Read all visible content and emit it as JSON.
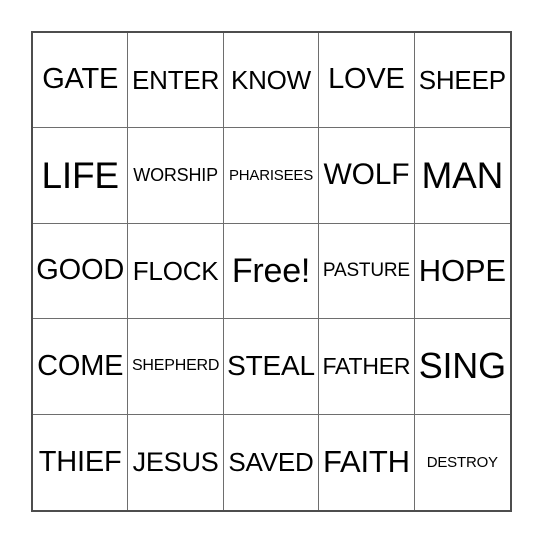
{
  "card": {
    "type": "bingo-card",
    "rows": 5,
    "columns": 5,
    "free_space": "Free!",
    "border_color": "#4d4d4d",
    "gridline_color": "#6e6e6e",
    "text_color": "#000000",
    "background_color": "#ffffff",
    "cells": [
      [
        {
          "label": "GATE",
          "size": "l"
        },
        {
          "label": "ENTER",
          "size": "m"
        },
        {
          "label": "KNOW",
          "size": "m"
        },
        {
          "label": "LOVE",
          "size": "l"
        },
        {
          "label": "SHEEP",
          "size": "m"
        }
      ],
      [
        {
          "label": "LIFE",
          "size": "xxl"
        },
        {
          "label": "WORSHIP",
          "size": "s"
        },
        {
          "label": "PHARISEES",
          "size": "xs"
        },
        {
          "label": "WOLF",
          "size": "xl"
        },
        {
          "label": "MAN",
          "size": "xxl"
        }
      ],
      [
        {
          "label": "GOOD",
          "size": "l"
        },
        {
          "label": "FLOCK",
          "size": "l"
        },
        {
          "label": "Free!",
          "size": "free"
        },
        {
          "label": "PASTURE",
          "size": "s"
        },
        {
          "label": "HOPE",
          "size": "xl"
        }
      ],
      [
        {
          "label": "COME",
          "size": "l"
        },
        {
          "label": "SHEPHERD",
          "size": "xs"
        },
        {
          "label": "STEAL",
          "size": "l"
        },
        {
          "label": "FATHER",
          "size": "m"
        },
        {
          "label": "SING",
          "size": "xxl"
        }
      ],
      [
        {
          "label": "THIEF",
          "size": "l"
        },
        {
          "label": "JESUS",
          "size": "l"
        },
        {
          "label": "SAVED",
          "size": "m"
        },
        {
          "label": "FAITH",
          "size": "xl"
        },
        {
          "label": "DESTROY",
          "size": "xxs"
        }
      ]
    ]
  }
}
